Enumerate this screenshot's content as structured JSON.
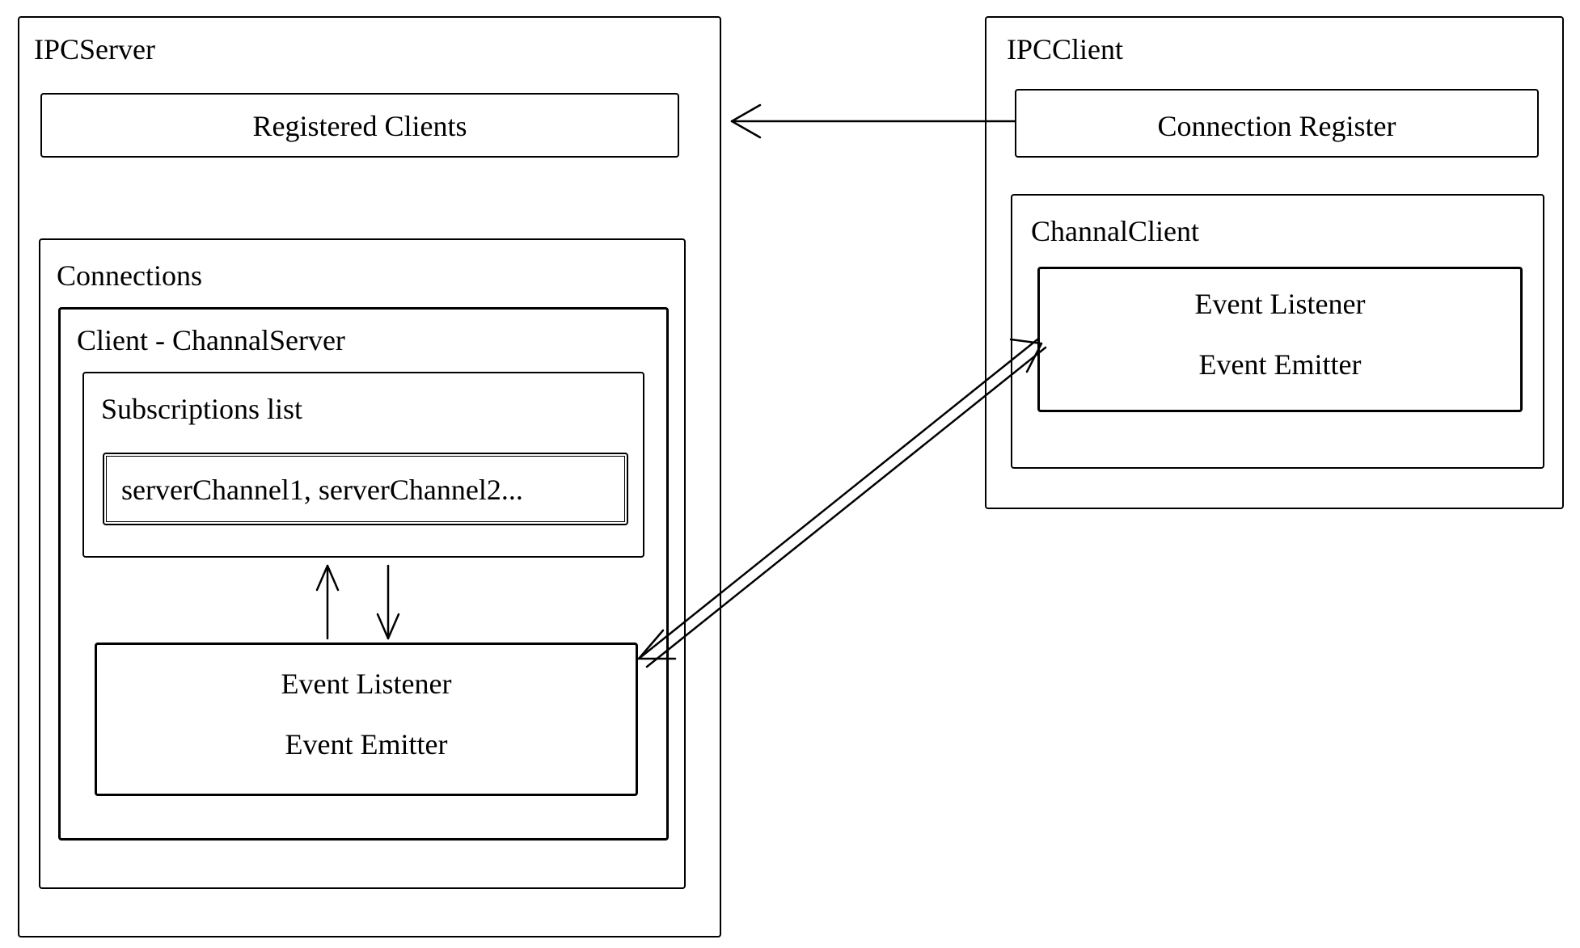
{
  "ipcServer": {
    "title": "IPCServer",
    "registeredClients": "Registered Clients",
    "connections": {
      "title": "Connections",
      "channelServer": {
        "title": "Client - ChannalServer",
        "subscriptions": {
          "title": "Subscriptions list",
          "content": "serverChannel1, serverChannel2..."
        },
        "eventListener": "Event Listener",
        "eventEmitter": "Event Emitter"
      }
    }
  },
  "ipcClient": {
    "title": "IPCClient",
    "connectionRegister": "Connection Register",
    "channelClient": {
      "title": "ChannalClient",
      "eventListener": "Event Listener",
      "eventEmitter": "Event Emitter"
    }
  }
}
